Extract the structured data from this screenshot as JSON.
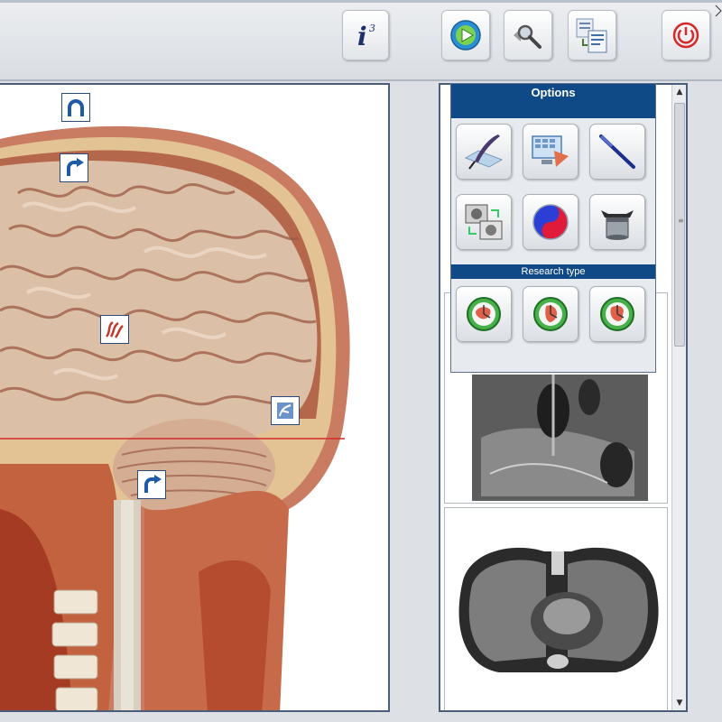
{
  "toolbar": {
    "buttons": [
      {
        "name": "info-button",
        "icon": "info-icon",
        "glyph": "i",
        "superscript": "3"
      },
      {
        "name": "play-button",
        "icon": "play-icon"
      },
      {
        "name": "search-button",
        "icon": "magnifier-icon"
      },
      {
        "name": "report-button",
        "icon": "document-icon"
      },
      {
        "name": "power-button",
        "icon": "power-icon"
      }
    ]
  },
  "viewer": {
    "hotspots": [
      {
        "name": "hotspot-top-arch",
        "icon": "arch-icon"
      },
      {
        "name": "hotspot-skull",
        "icon": "curved-arrow-icon"
      },
      {
        "name": "hotspot-vessels",
        "icon": "vessels-icon"
      },
      {
        "name": "hotspot-cerebellum",
        "icon": "organ-icon"
      },
      {
        "name": "hotspot-brainstem",
        "icon": "curved-arrow-icon"
      }
    ]
  },
  "options": {
    "title": "Options",
    "research_title": "Research type",
    "tools": [
      {
        "name": "pen-tool-button",
        "icon": "quill-icon"
      },
      {
        "name": "screen-compare-button",
        "icon": "monitor-icon"
      },
      {
        "name": "probe-button",
        "icon": "probe-icon"
      },
      {
        "name": "image-swap-button",
        "icon": "swap-images-icon"
      },
      {
        "name": "yin-yang-button",
        "icon": "yin-yang-icon"
      },
      {
        "name": "container-button",
        "icon": "pot-icon"
      }
    ],
    "research": [
      {
        "name": "research-type-1-button",
        "icon": "clock-target-icon"
      },
      {
        "name": "research-type-2-button",
        "icon": "clock-target-icon"
      },
      {
        "name": "research-type-3-button",
        "icon": "clock-target-icon"
      }
    ]
  },
  "colors": {
    "header_blue": "#0f4a87",
    "frame": "#4a5e7a",
    "power_red": "#d62a2a",
    "play_green": "#3cae3c"
  }
}
